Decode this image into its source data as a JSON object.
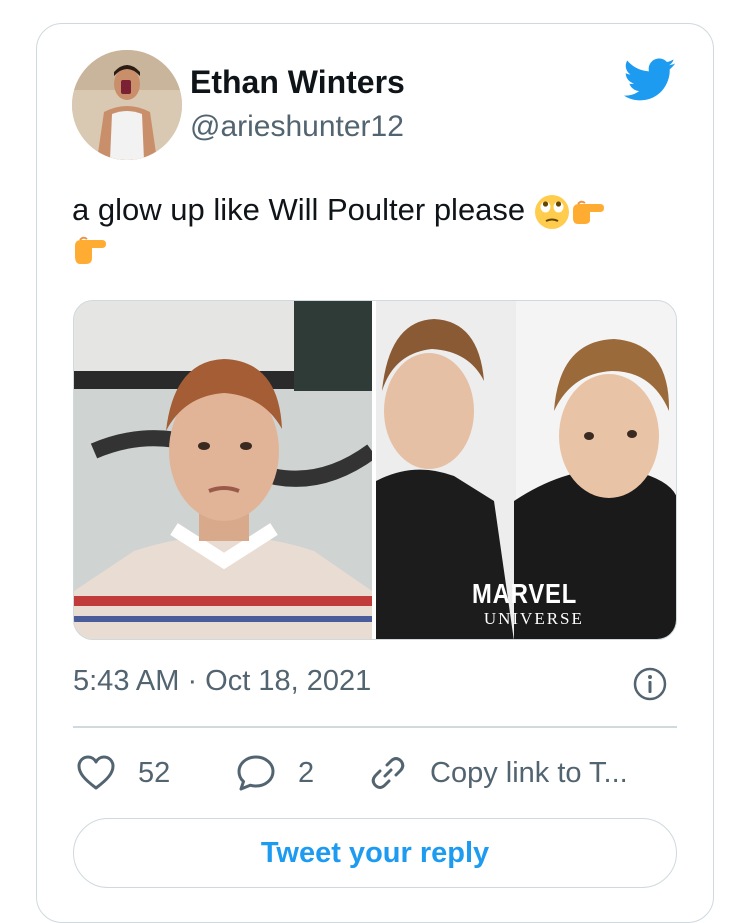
{
  "tweet": {
    "author": {
      "display_name": "Ethan Winters",
      "handle": "@arieshunter12"
    },
    "text": "a glow up like Will Poulter please",
    "emojis": [
      "face-with-rolling-eyes",
      "backhand-index-pointing-right",
      "backhand-index-pointing-right"
    ],
    "media_watermark": {
      "line1": "MARVEL",
      "line2": "UNIVERSE"
    },
    "timestamp": "5:43 AM · Oct 18, 2021"
  },
  "actions": {
    "like_count": "52",
    "reply_count": "2",
    "copy_link_label": "Copy link to T..."
  },
  "reply_button_label": "Tweet your reply",
  "icons": {
    "brand": "twitter-bird-icon",
    "info": "info-icon",
    "like": "heart-icon",
    "reply": "speech-bubble-icon",
    "link": "link-icon"
  },
  "colors": {
    "brand_blue": "#1d9bf0",
    "text_primary": "#0f1419",
    "text_secondary": "#536471",
    "border": "#cfd9de"
  }
}
